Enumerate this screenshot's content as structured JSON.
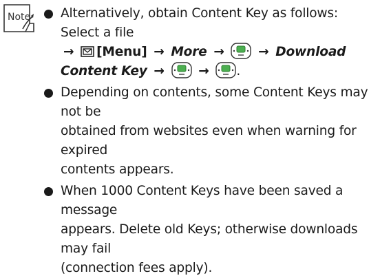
{
  "note_icon": {
    "label": "Note",
    "name": "note-icon"
  },
  "items": [
    {
      "line1": "Alternatively, obtain Content Key as follows: Select a file",
      "menu_label": "[Menu]",
      "more_label": "More",
      "download_label_1": "Download",
      "download_label_2": "Content Key",
      "period": "."
    },
    {
      "line1": "Depending on contents, some Content Keys may not be",
      "line2": "obtained from websites even when warning for expired",
      "line3": "contents appears."
    },
    {
      "line1": "When 1000 Content Keys have been saved a message",
      "line2": "appears. Delete old Keys; otherwise downloads may fail",
      "line3": "(connection fees apply)."
    }
  ],
  "icons": {
    "arrow": "→",
    "mail": "mail-key-icon",
    "center": "center-key-icon"
  }
}
